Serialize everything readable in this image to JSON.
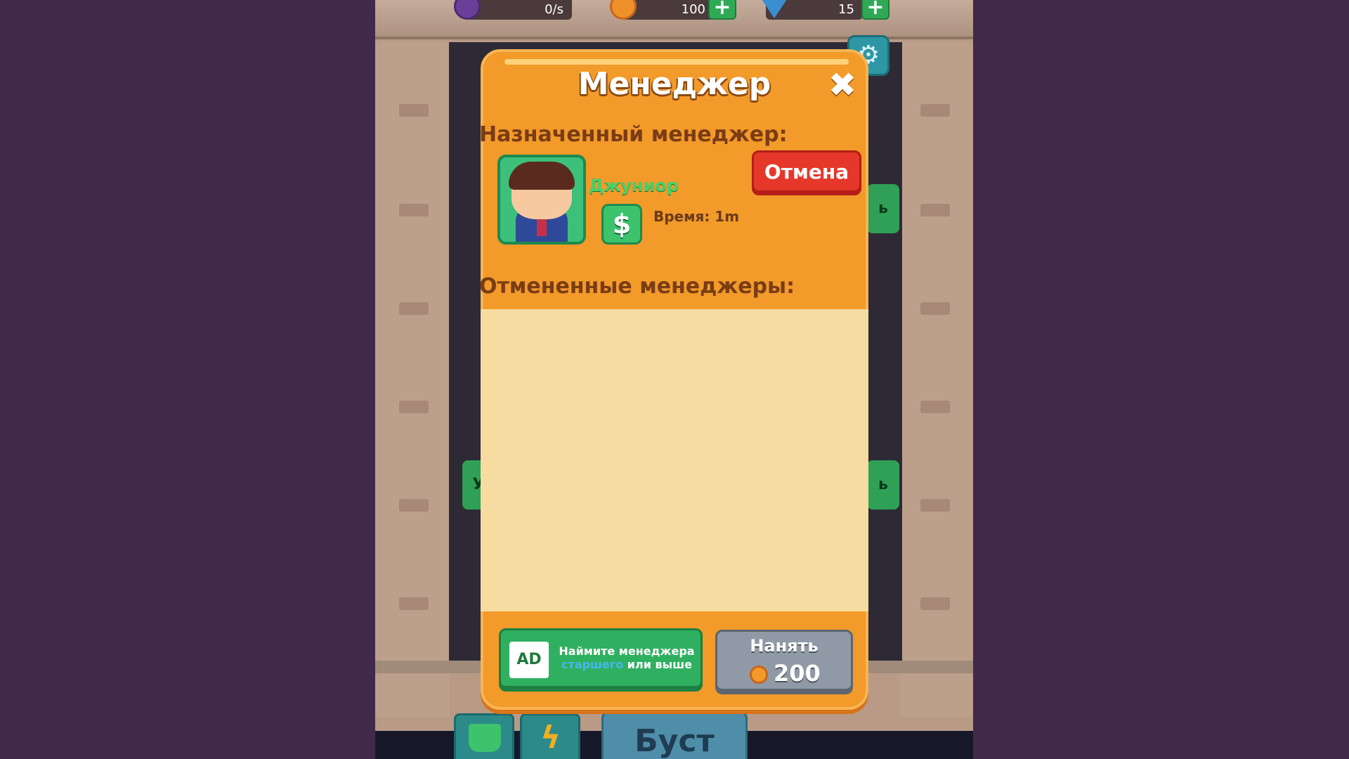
{
  "topbar": {
    "stat1_value": "0/s",
    "stat2_value": "100",
    "stat3_value": "15"
  },
  "dialog": {
    "title": "Менеджер",
    "assigned_label": "Назначенный менеджер:",
    "manager": {
      "name": "Джуниор",
      "badge_symbol": "$",
      "time_text": "Время: 1m"
    },
    "cancel_label": "Отмена",
    "cancelled_label": "Отмененные менеджеры:",
    "ad": {
      "icon_text": "AD",
      "line1": "Наймите менеджера",
      "highlight": "старшего",
      "line2_rest": " или выше"
    },
    "hire": {
      "label": "Нанять",
      "price": "200"
    }
  },
  "bottom": {
    "boost_label": "Буст"
  },
  "colors": {
    "dialog_orange": "#f29a2a",
    "cancel_red": "#e5372a",
    "ad_green": "#2fb060",
    "hire_gray": "#909aa6",
    "list_cream": "#f6dca1"
  },
  "icons": [
    "settings-icon",
    "close-icon",
    "dollar-icon",
    "ad-icon",
    "coin-icon",
    "gem-icon",
    "plus-icon",
    "lightning-icon",
    "basket-icon"
  ]
}
